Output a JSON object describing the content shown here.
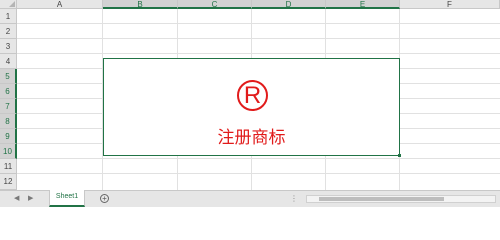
{
  "sheet": {
    "columns": [
      {
        "label": "A",
        "selected": false
      },
      {
        "label": "B",
        "selected": true
      },
      {
        "label": "C",
        "selected": true
      },
      {
        "label": "D",
        "selected": true
      },
      {
        "label": "E",
        "selected": true
      },
      {
        "label": "F",
        "selected": false
      }
    ],
    "rows": [
      {
        "label": "1",
        "selected": false
      },
      {
        "label": "2",
        "selected": false
      },
      {
        "label": "3",
        "selected": false
      },
      {
        "label": "4",
        "selected": false
      },
      {
        "label": "5",
        "selected": true
      },
      {
        "label": "6",
        "selected": true
      },
      {
        "label": "7",
        "selected": true
      },
      {
        "label": "8",
        "selected": true
      },
      {
        "label": "9",
        "selected": true
      },
      {
        "label": "10",
        "selected": true
      },
      {
        "label": "11",
        "selected": false
      },
      {
        "label": "12",
        "selected": false
      }
    ]
  },
  "shape": {
    "symbol": "R",
    "label": "注册商标",
    "accent_color": "#e11b1b",
    "border_color": "#217346"
  },
  "tabbar": {
    "sheet_tab": "Sheet1",
    "add_sheet": "+",
    "prev_arrow": "◀",
    "next_arrow": "▶",
    "more_dots": "⋮"
  },
  "theme": {
    "excel_green": "#217346",
    "header_bg": "#e6e6e6",
    "gridline": "#e1e1e1"
  }
}
